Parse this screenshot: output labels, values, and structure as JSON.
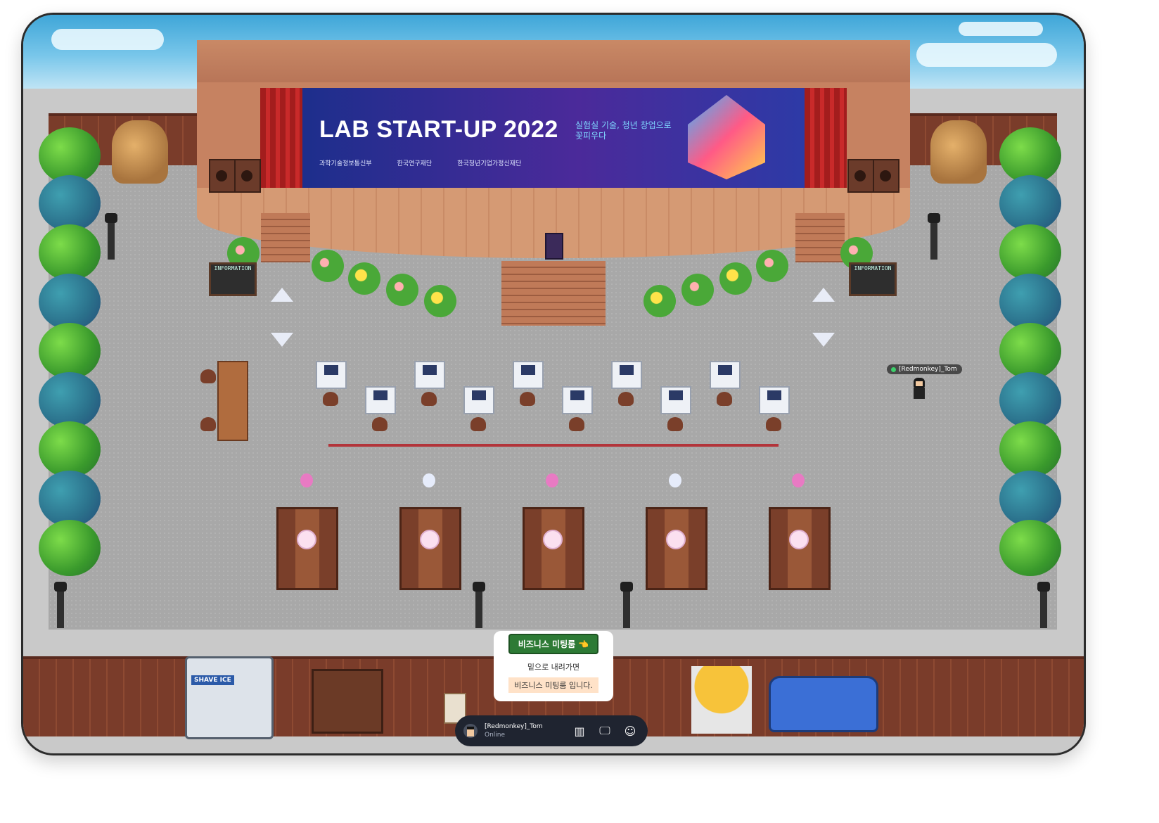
{
  "stage": {
    "banner_title": "LAB START-UP 2022",
    "banner_subtitle": "실험실 기술, 청년 창업으로 꽃피우다",
    "banner_logos": [
      "과학기술정보통신부",
      "한국연구재단",
      "한국청년기업가정신재단"
    ]
  },
  "info_boards": [
    "INFORMATION",
    "INFORMATION"
  ],
  "player": {
    "name": "[Redmonkey]_Tom",
    "status": "Online",
    "status_color": "#3ccf6a"
  },
  "notice": {
    "title": "비즈니스 미팅룸 👈",
    "line1": "밑으로 내려가면",
    "line2": "비즈니스 미팅룸 입니다."
  },
  "bottom_bar": {
    "icons": [
      "map-icon",
      "screen-share-icon",
      "emoji-icon"
    ],
    "map_glyph": "▥",
    "screen_glyph": "🖵",
    "emoji_glyph": "☺"
  },
  "food_truck_sign": "SHAVE ICE",
  "colors": {
    "balloon_pink": "#e87ac3",
    "balloon_white": "#e6ecfb"
  }
}
